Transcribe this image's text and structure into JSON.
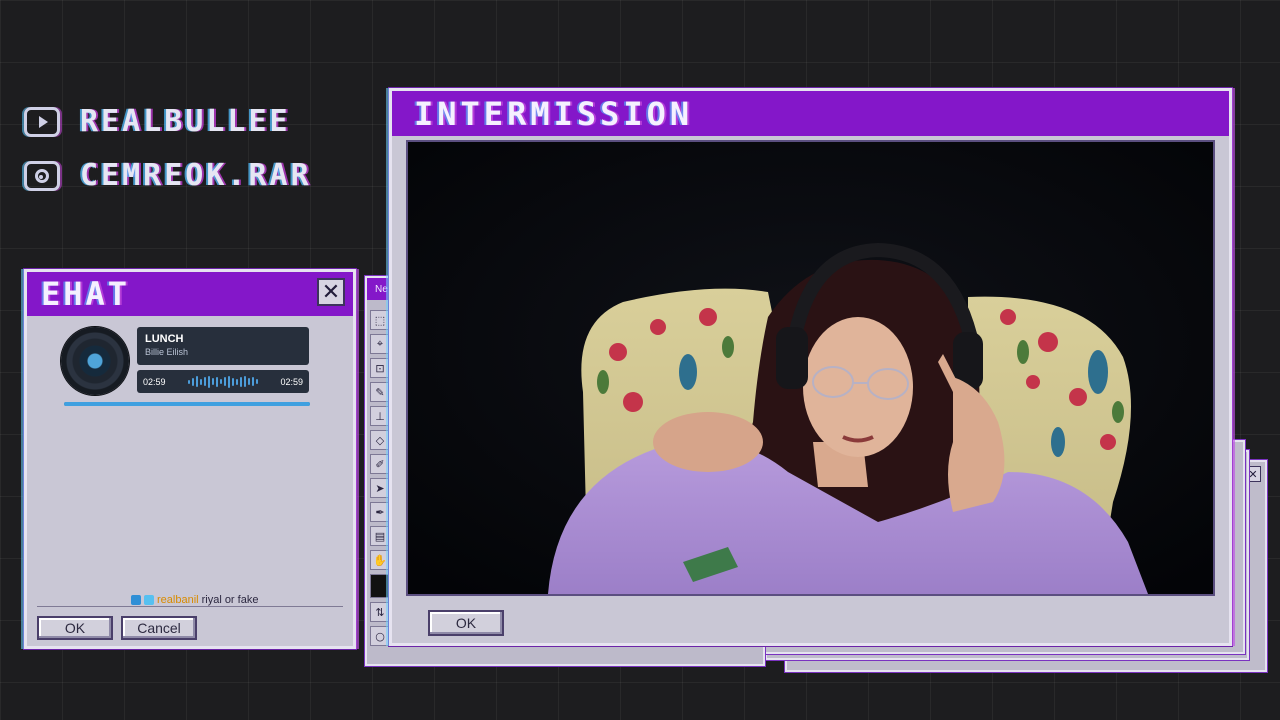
{
  "socials": {
    "youtube": {
      "icon": "youtube-icon",
      "handle": "REALBULLEE"
    },
    "instagram": {
      "icon": "instagram-icon",
      "handle": "CEMREOK.RAR"
    }
  },
  "chat": {
    "title": "EHAT",
    "close_label": "✕",
    "music": {
      "title": "LUNCH",
      "artist": "Billie Eilish",
      "time_elapsed": "02:59",
      "time_total": "02:59",
      "progress": 1.0
    },
    "message": {
      "user": "realbanil",
      "text": "riyal or fake"
    },
    "ok_label": "OK",
    "cancel_label": "Cancel"
  },
  "paint": {
    "title_fragment": "Ne"
  },
  "intermission": {
    "title": "INTERMISSION",
    "ok_label": "OK"
  },
  "colors": {
    "title_bar": "#8417c9",
    "window_body": "#c9c7d5",
    "background": "#1d1d1f",
    "accent_cyan": "#5ac8ff"
  }
}
